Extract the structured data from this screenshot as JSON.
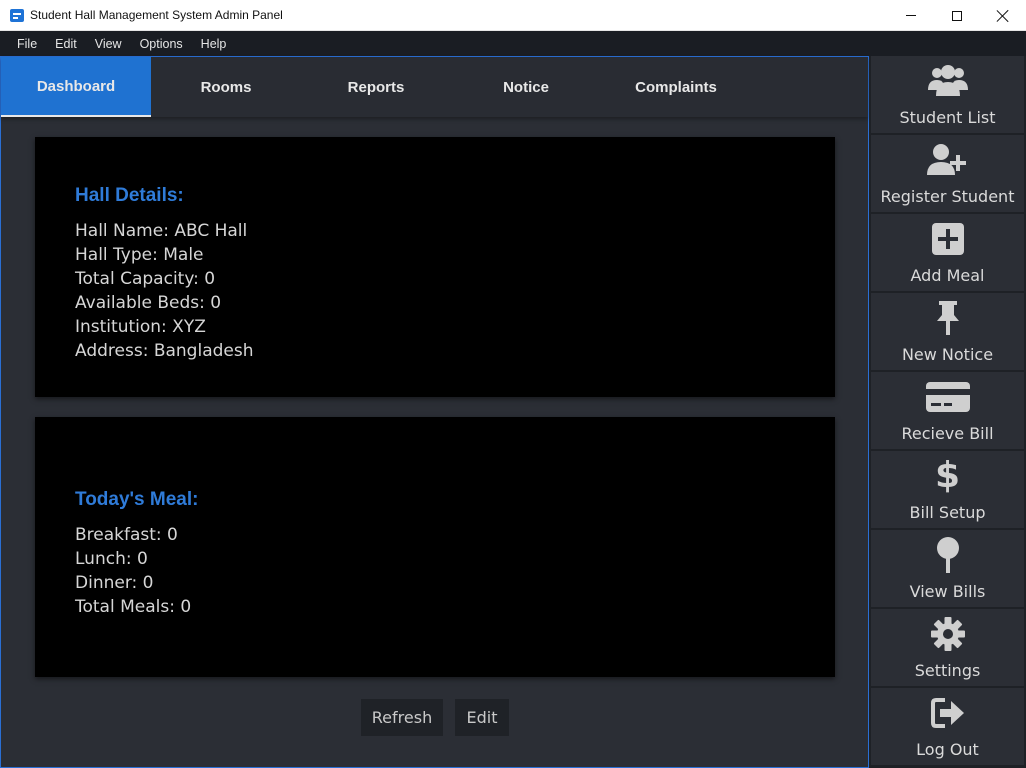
{
  "window": {
    "title": "Student Hall Management System Admin Panel"
  },
  "menu": [
    "File",
    "Edit",
    "View",
    "Options",
    "Help"
  ],
  "tabs": [
    {
      "label": "Dashboard",
      "active": true
    },
    {
      "label": "Rooms"
    },
    {
      "label": "Reports"
    },
    {
      "label": "Notice"
    },
    {
      "label": "Complaints"
    }
  ],
  "hall": {
    "title": "Hall Details:",
    "lines": [
      "Hall Name: ABC Hall",
      "Hall Type: Male",
      "Total Capacity: 0",
      "Available Beds: 0",
      "Institution: XYZ",
      "Address: Bangladesh"
    ]
  },
  "meal": {
    "title": "Today's Meal:",
    "lines": [
      "Breakfast: 0",
      "Lunch: 0",
      "Dinner: 0",
      "Total Meals: 0"
    ]
  },
  "buttons": {
    "refresh": "Refresh",
    "edit": "Edit"
  },
  "sidebar": {
    "items": [
      {
        "label": "Student List",
        "icon": "users-icon"
      },
      {
        "label": "Register Student",
        "icon": "user-plus-icon"
      },
      {
        "label": "Add Meal",
        "icon": "plus-square-icon"
      },
      {
        "label": "New Notice",
        "icon": "thumbtack-icon"
      },
      {
        "label": "Recieve Bill",
        "icon": "credit-card-icon"
      },
      {
        "label": "Bill Setup",
        "icon": "dollar-icon"
      },
      {
        "label": "View Bills",
        "icon": "map-pin-icon"
      },
      {
        "label": "Settings",
        "icon": "gear-icon"
      },
      {
        "label": "Log Out",
        "icon": "sign-out-icon"
      }
    ]
  },
  "colors": {
    "accent": "#1f72d1",
    "heading": "#2f7bd8",
    "panel": "#2b2e35",
    "card": "#000000"
  }
}
